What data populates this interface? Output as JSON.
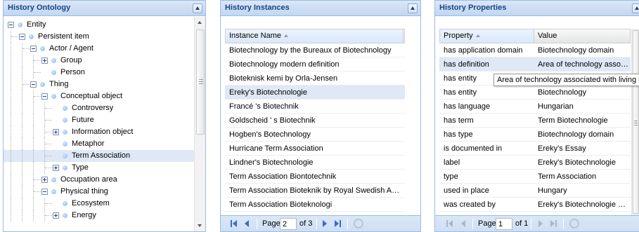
{
  "ontology": {
    "title": "History Ontology",
    "tree": [
      {
        "label": "Entity",
        "level": 0,
        "expander": "minus"
      },
      {
        "label": "Persistent item",
        "level": 1,
        "expander": "minus"
      },
      {
        "label": "Actor / Agent",
        "level": 2,
        "expander": "minus"
      },
      {
        "label": "Group",
        "level": 3,
        "expander": "plus"
      },
      {
        "label": "Person",
        "level": 3,
        "expander": "none"
      },
      {
        "label": "Thing",
        "level": 2,
        "expander": "minus"
      },
      {
        "label": "Conceptual object",
        "level": 3,
        "expander": "minus"
      },
      {
        "label": "Controversy",
        "level": 4,
        "expander": "none"
      },
      {
        "label": "Future",
        "level": 4,
        "expander": "none"
      },
      {
        "label": "Information object",
        "level": 4,
        "expander": "plus"
      },
      {
        "label": "Metaphor",
        "level": 4,
        "expander": "none"
      },
      {
        "label": "Term Association",
        "level": 4,
        "expander": "none",
        "selected": true
      },
      {
        "label": "Type",
        "level": 4,
        "expander": "plus"
      },
      {
        "label": "Occupation area",
        "level": 3,
        "expander": "plus"
      },
      {
        "label": "Physical thing",
        "level": 3,
        "expander": "minus"
      },
      {
        "label": "Ecosystem",
        "level": 4,
        "expander": "none"
      },
      {
        "label": "Energy",
        "level": 4,
        "expander": "plus"
      }
    ]
  },
  "instances": {
    "title": "History Instances",
    "column": "Instance Name",
    "rows": [
      "Biotechnology by the Bureaux of Biotechnology",
      "Biotechnology modern definition",
      "Bioteknisk kemi by Orla-Jensen",
      "Ereky's Biotechnologie",
      "Francé 's Biotechnik",
      "Goldscheid ' s Biotechnik",
      "Hogben's Botechnology",
      "Hurricane Term Association",
      "Lindner's Biotechnologie",
      "Term Association Biontotechnik",
      "Term Association Bioteknik by Royal Swedish Acade...",
      "Term Association Bioteknologi"
    ],
    "selected_index": 3,
    "pager": {
      "page_label": "Page",
      "page": "2",
      "of_label": "of 3"
    }
  },
  "properties": {
    "title": "History Properties",
    "columns": {
      "property": "Property",
      "value": "Value"
    },
    "rows": [
      {
        "property": "has application domain",
        "value": "Biotechnology domain"
      },
      {
        "property": "has definition",
        "value": "Area of technology associ..."
      },
      {
        "property": "has entity",
        "value": ""
      },
      {
        "property": "has entity",
        "value": "Biotechnology"
      },
      {
        "property": "has language",
        "value": "Hungarian"
      },
      {
        "property": "has term",
        "value": "Term Biotechnologie"
      },
      {
        "property": "has type",
        "value": "Biotechnology domain"
      },
      {
        "property": "is documented in",
        "value": "Ereky's Essay"
      },
      {
        "property": "label",
        "value": "Ereky's Biotechnologie"
      },
      {
        "property": "type",
        "value": "Term Association"
      },
      {
        "property": "used in place",
        "value": "Hungary"
      },
      {
        "property": "was created by",
        "value": "Ereky's Biotechnologie cre..."
      }
    ],
    "selected_index": 1,
    "tooltip": "Area of technology associated with living beings",
    "pager": {
      "page_label": "Page",
      "page": "1",
      "of_label": "of 1"
    }
  }
}
